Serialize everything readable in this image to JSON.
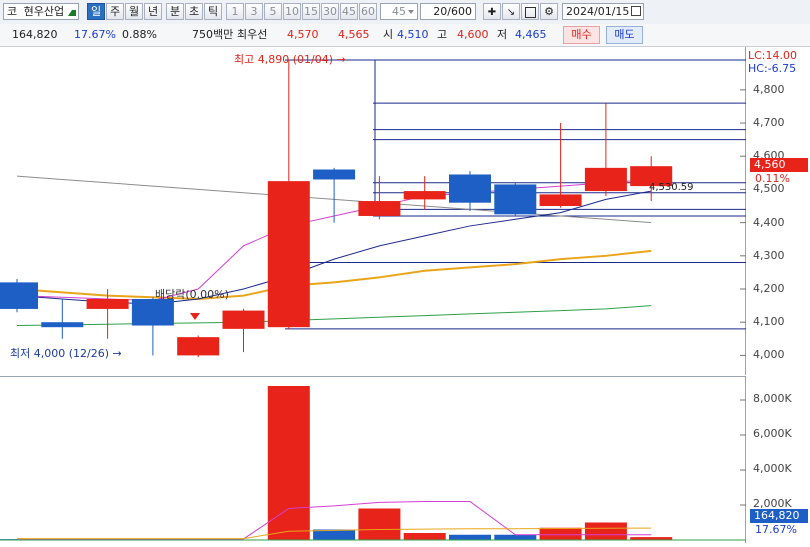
{
  "toolbar": {
    "code_prefix": "코",
    "stock_name": "현우산업",
    "periods": [
      "일",
      "주",
      "월",
      "년",
      "분",
      "초",
      "틱"
    ],
    "selected_period": "일",
    "intervals": [
      "1",
      "3",
      "5",
      "10",
      "15",
      "30",
      "45",
      "60"
    ],
    "interval_value": "45",
    "count_value": "20/600",
    "date": "2024/01/15"
  },
  "info": {
    "volume": "164,820",
    "volume_ratio": "17.67%",
    "change_rate": "0.88%",
    "amount_label": "750백만",
    "best_ask_label": "최우선",
    "best_ask": "4,570",
    "best_bid": "4,565",
    "open_label": "시",
    "open": "4,510",
    "high_label": "고",
    "high": "4,600",
    "low_label": "저",
    "low": "4,465",
    "buy_label": "매수",
    "sell_label": "매도"
  },
  "colors": {
    "up": "#e8231a",
    "down": "#1d5fc4",
    "ma5": "#d43fd4",
    "ma20": "#1a2a8c",
    "ma60": "#e8a51a",
    "ma120": "#2ea04a",
    "ma240": "#8c8c8c"
  },
  "annotations": {
    "high_note": "최고 4,890 (01/04) →",
    "low_note": "최저 4,000 (12/26) →",
    "dividend_note": "배당락(0.00%)",
    "mid_label": "4,530.59",
    "lc": "LC:14.00",
    "hc": "HC:-6.75",
    "current_price": "4,560",
    "current_rate": "0.11%",
    "vol_current": "164,820",
    "vol_rate": "17.67%"
  },
  "price_axis": [
    "4,800",
    "4,700",
    "4,600",
    "4,500",
    "4,400",
    "4,300",
    "4,200",
    "4,100",
    "4,000"
  ],
  "volume_axis": [
    "8,000K",
    "6,000K",
    "4,000K",
    "2,000K"
  ],
  "chart_data": {
    "type": "candlestick",
    "ylim": [
      3950,
      4920
    ],
    "candles": [
      {
        "o": 4220,
        "h": 4230,
        "l": 4130,
        "c": 4140
      },
      {
        "o": 4100,
        "h": 4170,
        "l": 4050,
        "c": 4085
      },
      {
        "o": 4140,
        "h": 4200,
        "l": 4050,
        "c": 4170
      },
      {
        "o": 4170,
        "h": 4175,
        "l": 4000,
        "c": 4090
      },
      {
        "o": 4000,
        "h": 4060,
        "l": 3995,
        "c": 4055
      },
      {
        "o": 4080,
        "h": 4140,
        "l": 4010,
        "c": 4135
      },
      {
        "o": 4085,
        "h": 4890,
        "l": 4080,
        "c": 4525
      },
      {
        "o": 4560,
        "h": 4565,
        "l": 4400,
        "c": 4530
      },
      {
        "o": 4420,
        "h": 4540,
        "l": 4410,
        "c": 4465
      },
      {
        "o": 4470,
        "h": 4540,
        "l": 4440,
        "c": 4495
      },
      {
        "o": 4545,
        "h": 4555,
        "l": 4435,
        "c": 4460
      },
      {
        "o": 4515,
        "h": 4520,
        "l": 4420,
        "c": 4425
      },
      {
        "o": 4450,
        "h": 4700,
        "l": 4445,
        "c": 4485
      },
      {
        "o": 4495,
        "h": 4760,
        "l": 4480,
        "c": 4565
      },
      {
        "o": 4510,
        "h": 4600,
        "l": 4465,
        "c": 4570
      }
    ],
    "volume_k": [
      50,
      50,
      80,
      40,
      30,
      30,
      8800,
      600,
      1800,
      400,
      300,
      300,
      700,
      1000,
      165
    ],
    "ma5": [
      4180,
      4175,
      4170,
      4165,
      4200,
      4330,
      4390,
      4420,
      4450,
      4480,
      4490,
      4500,
      4510,
      4520,
      4530
    ],
    "ma20": [
      4180,
      4170,
      4160,
      4155,
      4170,
      4200,
      4240,
      4290,
      4330,
      4360,
      4390,
      4410,
      4430,
      4470,
      4495
    ],
    "ma60": [
      4200,
      4190,
      4180,
      4175,
      4170,
      4180,
      4210,
      4220,
      4235,
      4255,
      4265,
      4275,
      4290,
      4300,
      4315
    ],
    "ma120": [
      4090,
      4092,
      4094,
      4096,
      4098,
      4100,
      4105,
      4110,
      4115,
      4120,
      4125,
      4130,
      4135,
      4140,
      4150
    ],
    "ma240": [
      4540,
      4530,
      4520,
      4510,
      4500,
      4490,
      4480,
      4470,
      4460,
      4450,
      4440,
      4430,
      4420,
      4410,
      4400
    ],
    "vol_ma5": [
      60,
      60,
      60,
      60,
      60,
      60,
      1800,
      1950,
      2150,
      2200,
      2200,
      300,
      300,
      300,
      300
    ],
    "vol_ma20": [
      80,
      80,
      80,
      80,
      80,
      80,
      500,
      550,
      600,
      620,
      640,
      640,
      660,
      670,
      680
    ],
    "hlines": [
      4890,
      4760,
      4680,
      4650,
      4520,
      4490,
      4440,
      4420,
      4280,
      4080
    ]
  }
}
